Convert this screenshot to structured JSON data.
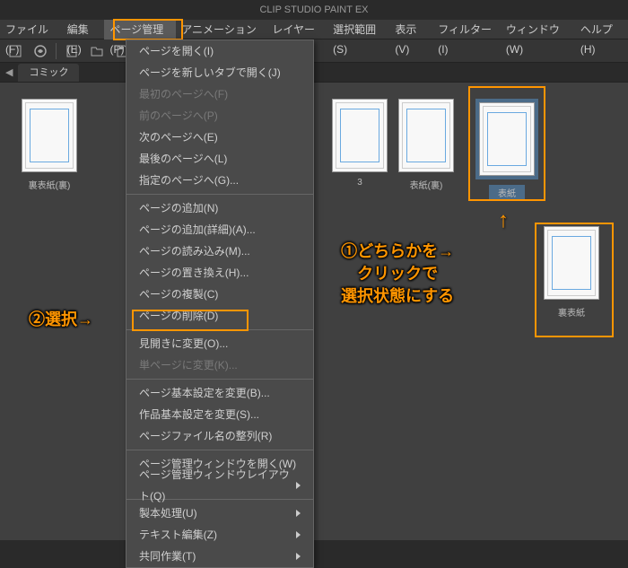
{
  "app": {
    "title": "CLIP STUDIO PAINT EX"
  },
  "menu": {
    "items": [
      {
        "label": "ファイル(F)"
      },
      {
        "label": "編集(E)"
      },
      {
        "label": "ページ管理(P)",
        "active": true
      },
      {
        "label": "アニメーション(A)"
      },
      {
        "label": "レイヤー(L)"
      },
      {
        "label": "選択範囲(S)"
      },
      {
        "label": "表示(V)"
      },
      {
        "label": "フィルター(I)"
      },
      {
        "label": "ウィンドウ(W)"
      },
      {
        "label": "ヘルプ(H)"
      }
    ]
  },
  "tab": {
    "label": "コミック"
  },
  "dropdown": {
    "groups": [
      [
        {
          "label": "ページを開く(I)"
        },
        {
          "label": "ページを新しいタブで開く(J)"
        },
        {
          "label": "最初のページへ(F)",
          "disabled": true
        },
        {
          "label": "前のページへ(P)",
          "disabled": true
        },
        {
          "label": "次のページへ(E)"
        },
        {
          "label": "最後のページへ(L)"
        },
        {
          "label": "指定のページへ(G)..."
        }
      ],
      [
        {
          "label": "ページの追加(N)"
        },
        {
          "label": "ページの追加(詳細)(A)..."
        },
        {
          "label": "ページの読み込み(M)..."
        },
        {
          "label": "ページの置き換え(H)..."
        },
        {
          "label": "ページの複製(C)"
        },
        {
          "label": "ページの削除(D)"
        }
      ],
      [
        {
          "label": "見開きに変更(O)...",
          "highlight": true
        },
        {
          "label": "単ページに変更(K)...",
          "disabled": true
        }
      ],
      [
        {
          "label": "ページ基本設定を変更(B)..."
        },
        {
          "label": "作品基本設定を変更(S)..."
        },
        {
          "label": "ページファイル名の整列(R)"
        }
      ],
      [
        {
          "label": "ページ管理ウィンドウを開く(W)"
        },
        {
          "label": "ページ管理ウィンドウレイアウト(Q)",
          "submenu": true
        }
      ],
      [
        {
          "label": "製本処理(U)",
          "submenu": true
        },
        {
          "label": "テキスト編集(Z)",
          "submenu": true
        },
        {
          "label": "共同作業(T)",
          "submenu": true
        }
      ]
    ]
  },
  "pages": {
    "first": {
      "label": "裏表紙(裏)"
    },
    "p3": {
      "label": "3"
    },
    "omote_ura": {
      "label": "表紙(裏)"
    },
    "omote": {
      "label": "表紙"
    },
    "ura": {
      "label": "裏表紙"
    }
  },
  "annotations": {
    "a2": "②選択→",
    "a1_line1": "①どちらかを→",
    "a1_line2": "クリックで",
    "a1_line3": "選択状態にする",
    "up": "↑"
  }
}
